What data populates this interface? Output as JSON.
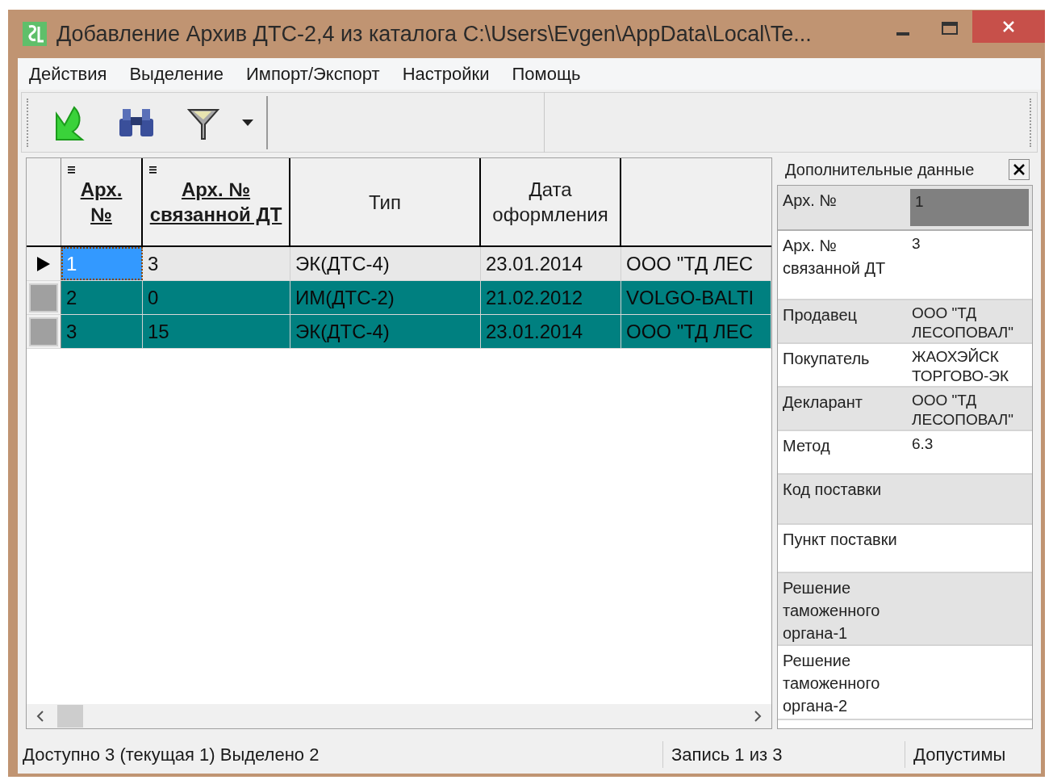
{
  "window": {
    "title": "Добавление Архив ДТС-2,4 из каталога C:\\Users\\Evgen\\AppData\\Local\\Te..."
  },
  "menu": [
    "Действия",
    "Выделение",
    "Импорт/Экспорт",
    "Настройки",
    "Помощь"
  ],
  "table": {
    "columns": [
      {
        "label": "Арх. №",
        "sortable": true
      },
      {
        "label": "Арх. № связанной ДТ",
        "sortable": true
      },
      {
        "label": "Тип",
        "sortable": false
      },
      {
        "label": "Дата оформления",
        "sortable": false
      }
    ],
    "rows": [
      {
        "current": true,
        "selected": false,
        "cells": [
          "1",
          "3",
          "ЭК(ДТС-4)",
          "23.01.2014",
          "ООО \"ТД ЛЕС"
        ]
      },
      {
        "current": false,
        "selected": true,
        "cells": [
          "2",
          "0",
          "ИМ(ДТС-2)",
          "21.02.2012",
          "VOLGO-BALTI"
        ]
      },
      {
        "current": false,
        "selected": true,
        "cells": [
          "3",
          "15",
          "ЭК(ДТС-4)",
          "23.01.2014",
          "ООО \"ТД ЛЕС"
        ]
      }
    ]
  },
  "details": {
    "title": "Дополнительные данные",
    "rows": [
      {
        "label": "Арх. №",
        "value": "1",
        "selected": true
      },
      {
        "label": "Арх. № связанной ДТ",
        "value": "3",
        "selected": false
      },
      {
        "label": "Продавец",
        "value": "ООО \"ТД ЛЕСОПОВАЛ\"",
        "selected": false
      },
      {
        "label": "Покупатель",
        "value": "ЖАОХЭЙСК ТОРГОВО-ЭК",
        "selected": false
      },
      {
        "label": "Декларант",
        "value": "ООО \"ТД ЛЕСОПОВАЛ\"",
        "selected": false
      },
      {
        "label": "Метод",
        "value": "6.3",
        "selected": false
      },
      {
        "label": "Код поставки",
        "selected": false
      },
      {
        "label": "Пункт поставки",
        "selected": false
      },
      {
        "label": "Решение таможенного органа-1",
        "selected": false
      },
      {
        "label": "Решение таможенного органа-2",
        "selected": false
      }
    ]
  },
  "status_bar": [
    "Доступно 3 (текущая 1) Выделено 2",
    "Запись 1 из 3",
    "Допустимы"
  ]
}
